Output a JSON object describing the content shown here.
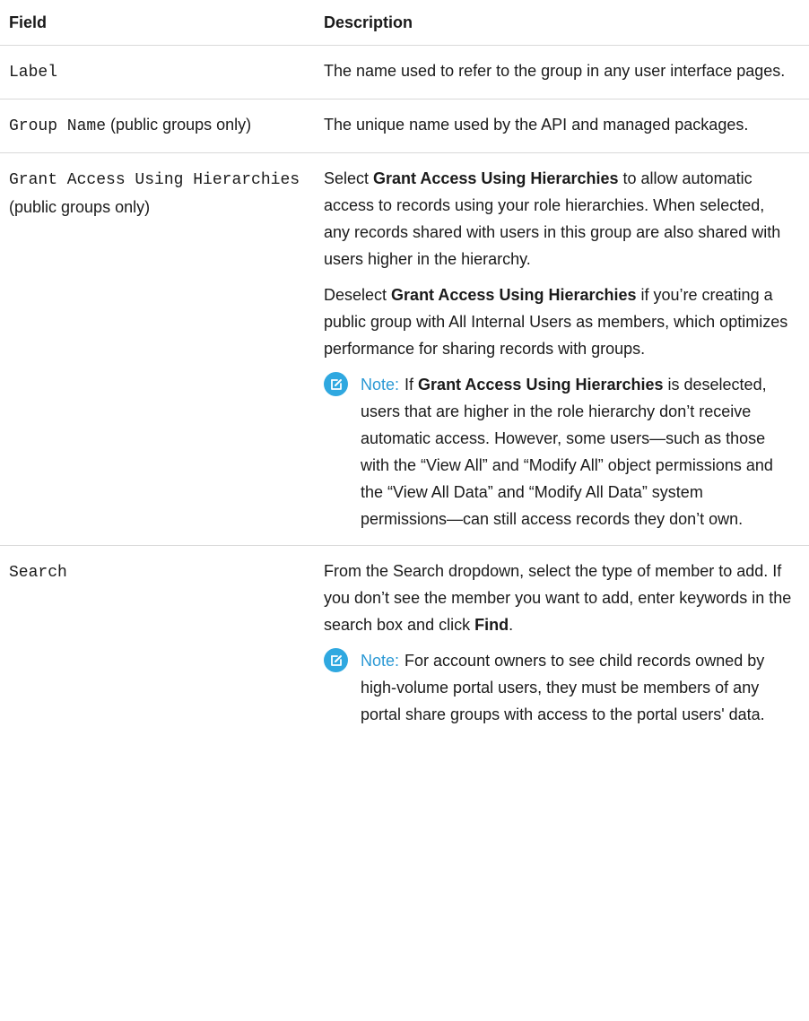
{
  "table": {
    "header_field": "Field",
    "header_description": "Description"
  },
  "rows": [
    {
      "field": "Label",
      "qualifier": "",
      "desc": "The name used to refer to the group in any user interface pages."
    },
    {
      "field": "Group Name",
      "qualifier": "(public groups only)",
      "desc": "The unique name used by the API and managed packages."
    },
    {
      "field": "Grant Access Using Hierarchies",
      "qualifier": "(public groups only)",
      "p1_pre": "Select ",
      "p1_bold": "Grant Access Using Hierarchies",
      "p1_post": " to allow automatic access to records using your role hierarchies. When selected, any records shared with users in this group are also shared with users higher in the hierarchy.",
      "p2_pre": "Deselect ",
      "p2_bold": "Grant Access Using Hierarchies",
      "p2_post": " if you’re creating a public group with All Internal Users as members, which optimizes performance for sharing records with groups.",
      "note_label": "Note:",
      "note_pre": "If ",
      "note_bold": "Grant Access Using Hierarchies",
      "note_post": " is deselected, users that are higher in the role hierarchy don’t receive automatic access. However, some users—such as those with the “View All” and “Modify All” object permissions and the “View All Data” and “Modify All Data” system permissions—can still access records they don’t own."
    },
    {
      "field": "Search",
      "qualifier": "",
      "p1_pre": "From the Search dropdown, select the type of member to add. If you don’t see the member you want to add, enter keywords in the search box and click ",
      "p1_bold": "Find",
      "p1_post": ".",
      "note_label": "Note:",
      "note_text": "For account owners to see child records owned by high-volume portal users, they must be members of any portal share groups with access to the portal users' data."
    }
  ],
  "icons": {
    "note_icon": "edit-note-icon",
    "note_color": "#2fa8e0"
  }
}
